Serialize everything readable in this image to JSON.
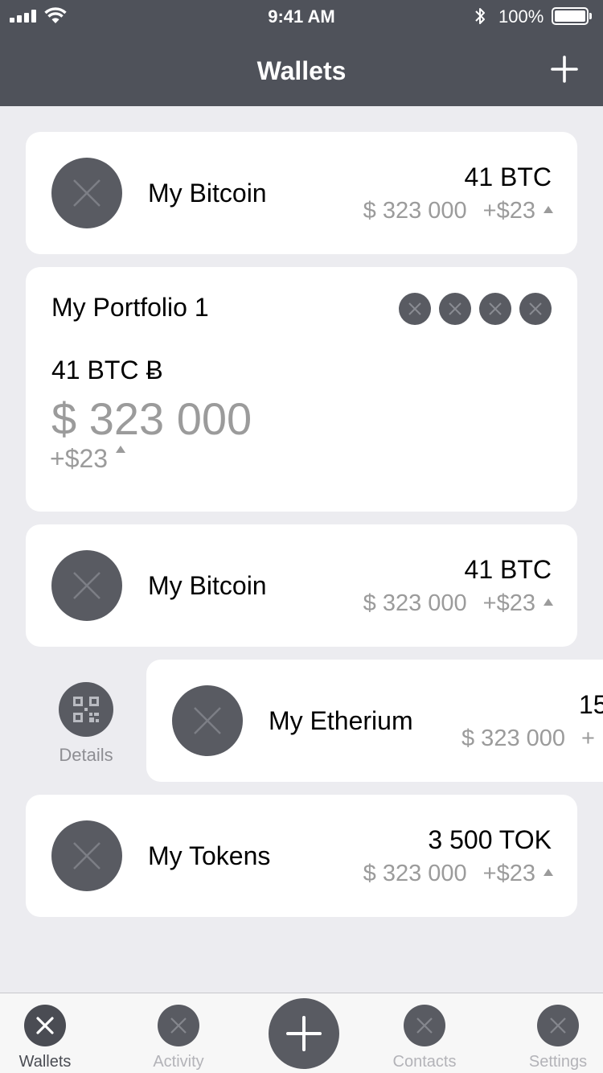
{
  "status_bar": {
    "time": "9:41 AM",
    "battery": "100%"
  },
  "nav": {
    "title": "Wallets"
  },
  "wallets": [
    {
      "name": "My Bitcoin",
      "amount": "41 BTC",
      "usd": "$ 323 000",
      "change": "+$23"
    },
    {
      "name": "My Bitcoin",
      "amount": "41 BTC",
      "usd": "$ 323 000",
      "change": "+$23"
    },
    {
      "name": "My Etherium",
      "amount": "15",
      "usd": "$ 323 000",
      "change": "+"
    },
    {
      "name": "My Tokens",
      "amount": "3 500 TOK",
      "usd": "$ 323 000",
      "change": "+$23"
    }
  ],
  "portfolio": {
    "title": "My Portfolio 1",
    "btc": "41 BTC Ƀ",
    "usd": "$ 323 000",
    "change": "+$23"
  },
  "swipe_action": {
    "label": "Details"
  },
  "tabs": [
    {
      "label": "Wallets",
      "active": true
    },
    {
      "label": "Activity",
      "active": false
    },
    {
      "label": "Contacts",
      "active": false
    },
    {
      "label": "Settings",
      "active": false
    }
  ],
  "colors": {
    "nav_bg": "#4f525a",
    "icon_bg": "#595b62",
    "screen_bg": "#ececf0",
    "muted_text": "#9b9b9b"
  }
}
